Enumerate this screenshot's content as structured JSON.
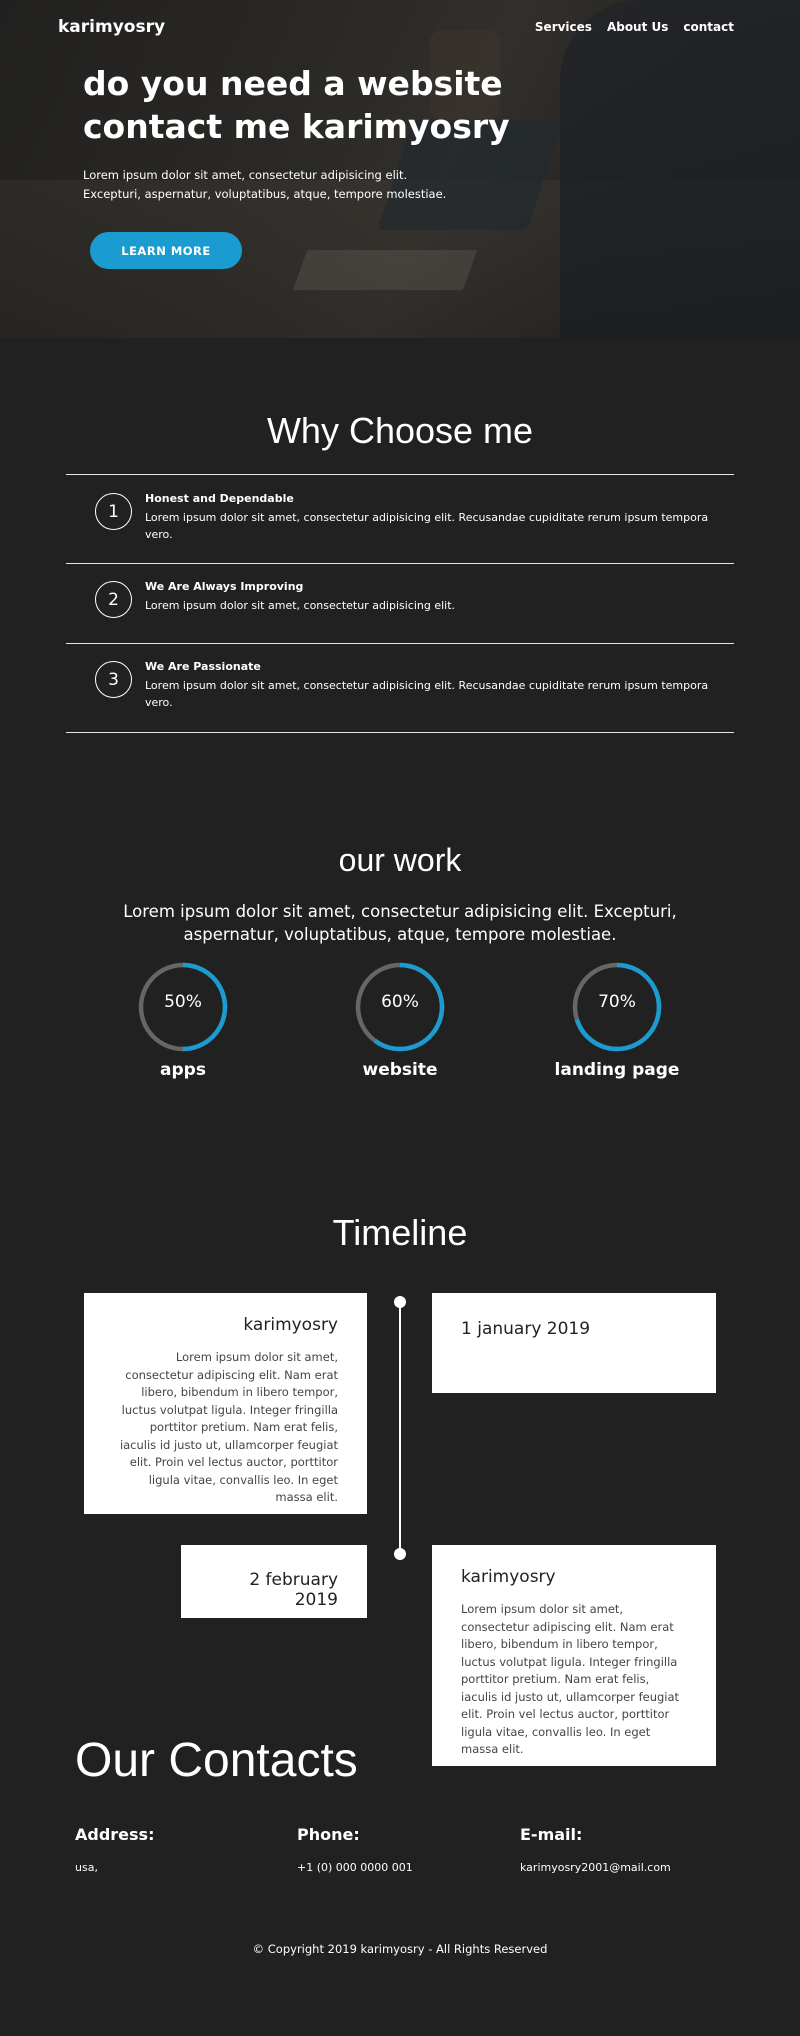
{
  "header": {
    "brand": "karimyosry",
    "menu": [
      "Services",
      "About Us",
      "contact"
    ]
  },
  "hero": {
    "title_line1": "do you need a website",
    "title_line2": "contact me karimyosry",
    "text": "Lorem ipsum dolor sit amet, consectetur adipisicing elit. Excepturi, aspernatur, voluptatibus, atque, tempore molestiae.",
    "button": "LEARN MORE"
  },
  "why": {
    "title": "Why Choose me",
    "items": [
      {
        "num": "1",
        "title": "Honest and Dependable",
        "text": "Lorem ipsum dolor sit amet, consectetur adipisicing elit. Recusandae cupiditate rerum ipsum tempora vero."
      },
      {
        "num": "2",
        "title": "We Are Always Improving",
        "text": "Lorem ipsum dolor sit amet, consectetur adipisicing elit."
      },
      {
        "num": "3",
        "title": "We Are Passionate",
        "text": "Lorem ipsum dolor sit amet, consectetur adipisicing elit. Recusandae cupiditate rerum ipsum tempora vero."
      }
    ]
  },
  "work": {
    "title": "our work",
    "text": "Lorem ipsum dolor sit amet, consectetur adipisicing elit. Excepturi, aspernatur, voluptatibus, atque, tempore molestiae.",
    "items": [
      {
        "pct": "50%",
        "value": 50,
        "label": "apps"
      },
      {
        "pct": "60%",
        "value": 60,
        "label": "website"
      },
      {
        "pct": "70%",
        "value": 70,
        "label": "landing page"
      }
    ]
  },
  "timeline": {
    "title": "Timeline",
    "entries": [
      {
        "name": "karimyosry",
        "date": "1 january 2019",
        "text": "Lorem ipsum dolor sit amet, consectetur adipiscing elit. Nam erat libero, bibendum in libero tempor, luctus volutpat ligula. Integer fringilla porttitor pretium. Nam erat felis, iaculis id justo ut, ullamcorper feugiat elit. Proin vel lectus auctor, porttitor ligula vitae, convallis leo. In eget massa elit."
      },
      {
        "name": "karimyosry",
        "date": "2 february 2019",
        "text": "Lorem ipsum dolor sit amet, consectetur adipiscing elit. Nam erat libero, bibendum in libero tempor, luctus volutpat ligula. Integer fringilla porttitor pretium. Nam erat felis, iaculis id justo ut, ullamcorper feugiat elit. Proin vel lectus auctor, porttitor ligula vitae, convallis leo. In eget massa elit."
      }
    ]
  },
  "contacts": {
    "title": "Our Contacts",
    "address_label": "Address:",
    "address_value": "usa,",
    "phone_label": "Phone:",
    "phone_value": "+1 (0) 000 0000 001",
    "email_label": "E-mail:",
    "email_value": "karimyosry2001@mail.com"
  },
  "footer": {
    "copyright": "© Copyright 2019 karimyosry - All Rights Reserved"
  },
  "colors": {
    "background": "#212121",
    "accent": "#1a9cd1",
    "gauge_track": "#666666",
    "card": "#ffffff"
  }
}
